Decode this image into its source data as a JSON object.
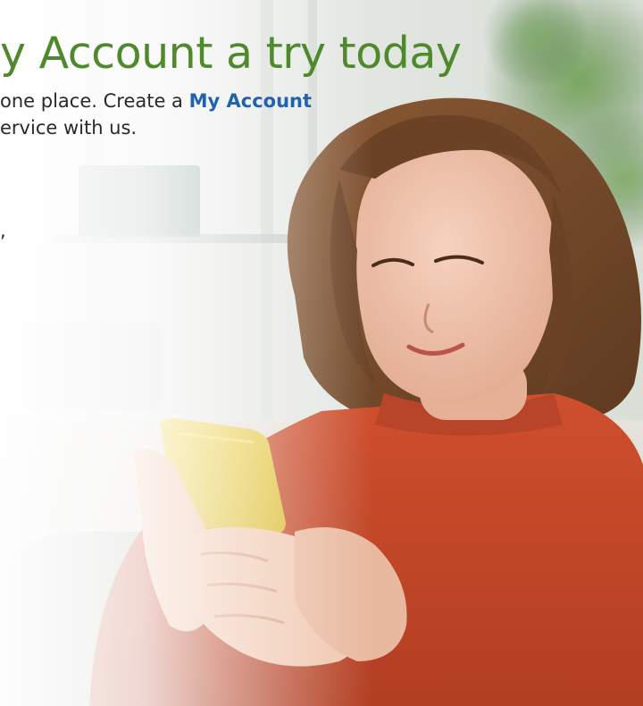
{
  "hero": {
    "headline": "y Account a try today",
    "body_line_1_prefix": "one place. Create a ",
    "body_link": "My Account",
    "body_line_2": "ervice with us.",
    "stray_char": ","
  },
  "colors": {
    "headline": "#4e8a2c",
    "link": "#1f63b0",
    "body": "#2a2a2a",
    "sweater": "#c8472a",
    "phone": "#e9cc44"
  },
  "image": {
    "subject": "woman-smiling-at-phone"
  }
}
